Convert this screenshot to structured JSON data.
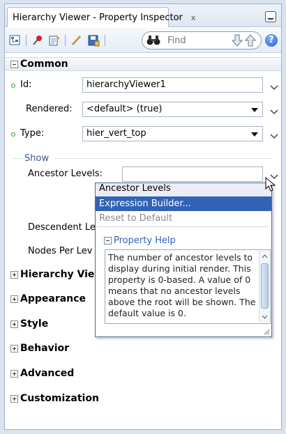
{
  "window": {
    "title": "Hierarchy Viewer - Property Inspector",
    "close_glyph": "x"
  },
  "toolbar": {
    "find_placeholder": "Find",
    "help_glyph": "?",
    "icons": [
      "tree-icon",
      "pin-icon",
      "edit-page-icon",
      "pencil-icon",
      "save-icon",
      "binoculars-icon",
      "down-arrow-icon",
      "up-arrow-icon",
      "help-icon"
    ]
  },
  "sections": {
    "common": "Common",
    "hierarchy_viewer": "Hierarchy Vie",
    "appearance": "Appearance",
    "style": "Style",
    "behavior": "Behavior",
    "advanced": "Advanced",
    "customization": "Customization"
  },
  "properties": {
    "id": {
      "label": "Id:",
      "value": "hierarchyViewer1"
    },
    "rendered": {
      "label": "Rendered:",
      "value": "<default> (true)"
    },
    "type": {
      "label": "Type:",
      "value": "hier_vert_top"
    },
    "show_group": "Show",
    "ancestor_levels": {
      "label": "Ancestor Levels:",
      "value": ""
    },
    "descendent_levels": {
      "label": "Descendent Le"
    },
    "nodes_per_level": {
      "label": "Nodes Per Lev"
    }
  },
  "popup": {
    "title": "Ancestor Levels",
    "items": [
      "Expression Builder...",
      "Reset to Default"
    ],
    "help_title": "Property Help",
    "help_text": "The number of ancestor levels to display during initial render. This property is 0-based. A value of 0 means that no ancestor levels above the root will be shown. The default value is 0."
  },
  "colors": {
    "selection": "#3162b5",
    "required_marker": "#2a9a2a",
    "group_label": "#3a5a8a"
  }
}
